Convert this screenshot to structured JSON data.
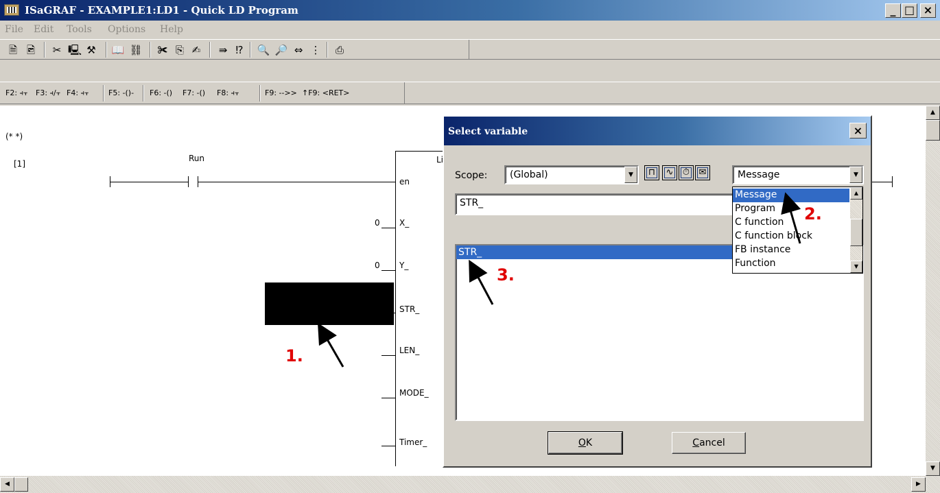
{
  "window": {
    "title": "ISaGRAF - EXAMPLE1:LD1 - Quick LD Program",
    "minimize": "_",
    "maximize": "□",
    "close": "×"
  },
  "menu": {
    "items": [
      "File",
      "Edit",
      "Tools",
      "Options",
      "Help"
    ]
  },
  "function_keys": {
    "f2": "F2: ⫞⫟",
    "f3": "F3: ⫞/⫟",
    "f4": "F4: ⫞⫟",
    "f5": "F5: -()-",
    "f6": "F6: -()",
    "f7": "F7: -()",
    "f8": "F8: ⫞⫟",
    "f9": "F9: -->>",
    "sf9": "↑F9: <RET>"
  },
  "ladder": {
    "comment": "(* *)",
    "rung_number": "[1]",
    "contact_label": "Run",
    "block_name_partial": "Li",
    "pins": [
      "en",
      "X_",
      "Y_",
      "STR_",
      "LEN_",
      "MODE_",
      "Timer_"
    ],
    "x_value": "0",
    "y_value": "0"
  },
  "dialog": {
    "title": "Select variable",
    "close": "×",
    "scope_label": "Scope:",
    "scope_value": "(Global)",
    "type_value": "Message",
    "name_field": "STR_",
    "list_items": [
      "STR_"
    ],
    "ok_label": "OK",
    "cancel_label": "Cancel"
  },
  "dropdown": {
    "items": [
      "Message",
      "Program",
      "C function",
      "C function block",
      "FB instance",
      "Function"
    ],
    "selected": "Message"
  },
  "markers": {
    "m1": "1.",
    "m2": "2.",
    "m3": "3."
  }
}
